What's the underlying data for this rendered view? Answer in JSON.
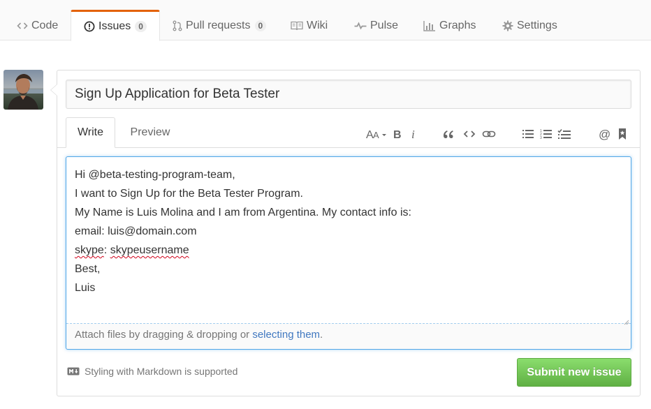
{
  "nav": {
    "tabs": [
      {
        "label": "Code",
        "icon": "code-icon"
      },
      {
        "label": "Issues",
        "icon": "issue-opened-icon",
        "count": "0",
        "selected": true
      },
      {
        "label": "Pull requests",
        "icon": "git-pull-request-icon",
        "count": "0"
      },
      {
        "label": "Wiki",
        "icon": "book-icon"
      },
      {
        "label": "Pulse",
        "icon": "pulse-icon"
      },
      {
        "label": "Graphs",
        "icon": "graph-icon"
      },
      {
        "label": "Settings",
        "icon": "gear-icon"
      }
    ]
  },
  "issue": {
    "title_value": "Sign Up Application for Beta Tester",
    "tabs": {
      "write": "Write",
      "preview": "Preview"
    },
    "toolbar": [
      "header-icon",
      "bold-icon",
      "italic-icon",
      "quote-icon",
      "code-icon",
      "link-icon",
      "unordered-list-icon",
      "ordered-list-icon",
      "task-list-icon",
      "mention-icon",
      "bookmark-icon"
    ],
    "body": {
      "line1": "Hi @beta-testing-program-team,",
      "line2": "I want to Sign Up for the Beta Tester Program.",
      "line3": "My Name is Luis Molina and I am from Argentina. My contact info is:",
      "line4": "email: luis@domain.com",
      "line5_label": "skype",
      "line5_sep": ": ",
      "line5_value": "skypeusername",
      "line6": "Best,",
      "line7": "Luis"
    },
    "attach": {
      "text": "Attach files by dragging & dropping or ",
      "link": "selecting them",
      "suffix": "."
    },
    "markdown_hint": "Styling with Markdown is supported",
    "submit_label": "Submit new issue"
  },
  "colors": {
    "accent_tab": "#e36209",
    "submit_green": "#60b044",
    "link_blue": "#4078c0",
    "focus_blue": "#51a7e8"
  }
}
